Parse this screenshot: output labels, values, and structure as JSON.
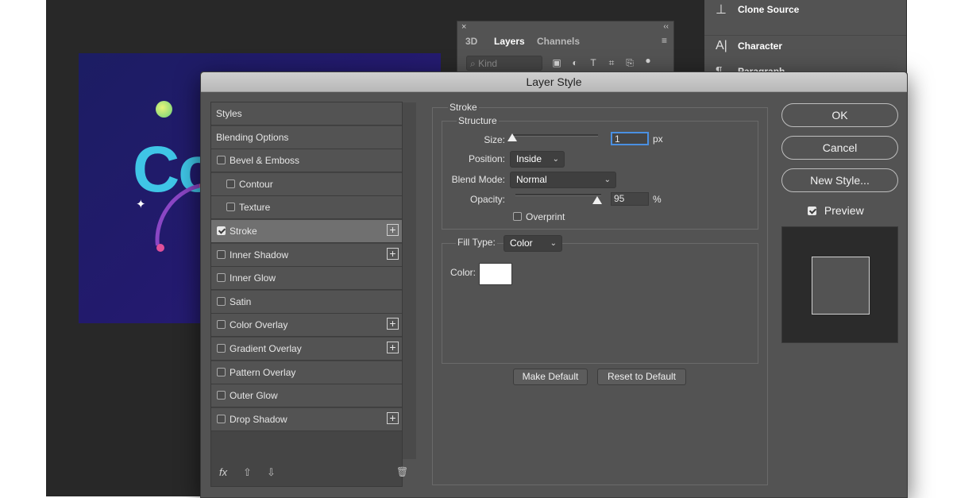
{
  "layers_panel": {
    "close_glyph": "×",
    "collapse_glyph": "‹‹",
    "tabs": [
      "3D",
      "Layers",
      "Channels"
    ],
    "active_tab": "Layers",
    "menu_glyph": "≡",
    "filter_placeholder": "Kind"
  },
  "right_panel": {
    "clone_source": "Clone Source",
    "character": "Character",
    "paragraph": "Paragraph"
  },
  "canvas": {
    "art_text": "Co"
  },
  "dialog": {
    "title": "Layer Style",
    "styles_list": [
      {
        "label": "Styles",
        "checkbox": false,
        "plus": false
      },
      {
        "label": "Blending Options",
        "checkbox": false,
        "plus": false
      },
      {
        "label": "Bevel & Emboss",
        "checkbox": true,
        "checked": false,
        "plus": false
      },
      {
        "label": "Contour",
        "checkbox": true,
        "checked": false,
        "plus": false,
        "sub": true
      },
      {
        "label": "Texture",
        "checkbox": true,
        "checked": false,
        "plus": false,
        "sub": true
      },
      {
        "label": "Stroke",
        "checkbox": true,
        "checked": true,
        "plus": true,
        "selected": true
      },
      {
        "label": "Inner Shadow",
        "checkbox": true,
        "checked": false,
        "plus": true
      },
      {
        "label": "Inner Glow",
        "checkbox": true,
        "checked": false,
        "plus": false
      },
      {
        "label": "Satin",
        "checkbox": true,
        "checked": false,
        "plus": false
      },
      {
        "label": "Color Overlay",
        "checkbox": true,
        "checked": false,
        "plus": true
      },
      {
        "label": "Gradient Overlay",
        "checkbox": true,
        "checked": false,
        "plus": true
      },
      {
        "label": "Pattern Overlay",
        "checkbox": true,
        "checked": false,
        "plus": false
      },
      {
        "label": "Outer Glow",
        "checkbox": true,
        "checked": false,
        "plus": false
      },
      {
        "label": "Drop Shadow",
        "checkbox": true,
        "checked": false,
        "plus": true
      }
    ],
    "footer": {
      "fx": "fx",
      "up": "⇧",
      "down": "⇩",
      "trash": "🗑"
    },
    "stroke": {
      "group_title": "Stroke",
      "structure_title": "Structure",
      "size_label": "Size:",
      "size_value": "1",
      "size_unit": "px",
      "size_slider_fraction": 0.0,
      "position_label": "Position:",
      "position_value": "Inside",
      "blend_mode_label": "Blend Mode:",
      "blend_mode_value": "Normal",
      "opacity_label": "Opacity:",
      "opacity_value": "95",
      "opacity_unit": "%",
      "opacity_slider_fraction": 0.95,
      "overprint_label": "Overprint",
      "overprint_checked": false,
      "fill_type_label": "Fill Type:",
      "fill_type_value": "Color",
      "color_label": "Color:",
      "color_value": "#ffffff",
      "make_default": "Make Default",
      "reset_default": "Reset to Default"
    },
    "buttons": {
      "ok": "OK",
      "cancel": "Cancel",
      "new_style": "New Style...",
      "preview": "Preview",
      "preview_checked": true
    }
  }
}
